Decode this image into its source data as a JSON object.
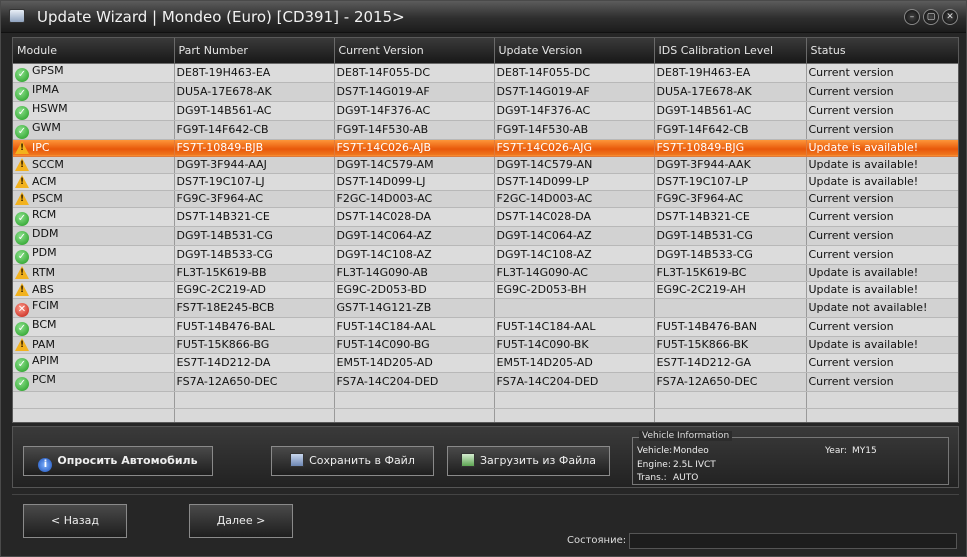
{
  "window": {
    "title": "Update Wizard | Mondeo (Euro) [CD391] - 2015>"
  },
  "table": {
    "columns": [
      "Module",
      "Part Number",
      "Current Version",
      "Update Version",
      "IDS Calibration Level",
      "Status"
    ],
    "rows": [
      {
        "status_icon": "ok",
        "module": "GPSM",
        "part": "DE8T-19H463-EA",
        "current": "DE8T-14F055-DC",
        "update": "DE8T-14F055-DC",
        "ids": "DE8T-19H463-EA",
        "status": "Current version"
      },
      {
        "status_icon": "ok",
        "module": "IPMA",
        "part": "DU5A-17E678-AK",
        "current": "DS7T-14G019-AF",
        "update": "DS7T-14G019-AF",
        "ids": "DU5A-17E678-AK",
        "status": "Current version"
      },
      {
        "status_icon": "ok",
        "module": "HSWM",
        "part": "DG9T-14B561-AC",
        "current": "DG9T-14F376-AC",
        "update": "DG9T-14F376-AC",
        "ids": "DG9T-14B561-AC",
        "status": "Current version"
      },
      {
        "status_icon": "ok",
        "module": "GWM",
        "part": "FG9T-14F642-CB",
        "current": "FG9T-14F530-AB",
        "update": "FG9T-14F530-AB",
        "ids": "FG9T-14F642-CB",
        "status": "Current version"
      },
      {
        "status_icon": "warn",
        "module": "IPC",
        "part": "FS7T-10849-BJB",
        "current": "FS7T-14C026-AJB",
        "update": "FS7T-14C026-AJG",
        "ids": "FS7T-10849-BJG",
        "status": "Update is available!",
        "selected": true
      },
      {
        "status_icon": "warn",
        "module": "SCCM",
        "part": "DG9T-3F944-AAJ",
        "current": "DG9T-14C579-AM",
        "update": "DG9T-14C579-AN",
        "ids": "DG9T-3F944-AAK",
        "status": "Update is available!"
      },
      {
        "status_icon": "warn",
        "module": "ACM",
        "part": "DS7T-19C107-LJ",
        "current": "DS7T-14D099-LJ",
        "update": "DS7T-14D099-LP",
        "ids": "DS7T-19C107-LP",
        "status": "Update is available!"
      },
      {
        "status_icon": "warn",
        "module": "PSCM",
        "part": "FG9C-3F964-AC",
        "current": "F2GC-14D003-AC",
        "update": "F2GC-14D003-AC",
        "ids": "FG9C-3F964-AC",
        "status": "Current version"
      },
      {
        "status_icon": "ok",
        "module": "RCM",
        "part": "DS7T-14B321-CE",
        "current": "DS7T-14C028-DA",
        "update": "DS7T-14C028-DA",
        "ids": "DS7T-14B321-CE",
        "status": "Current version"
      },
      {
        "status_icon": "ok",
        "module": "DDM",
        "part": "DG9T-14B531-CG",
        "current": "DG9T-14C064-AZ",
        "update": "DG9T-14C064-AZ",
        "ids": "DG9T-14B531-CG",
        "status": "Current version"
      },
      {
        "status_icon": "ok",
        "module": "PDM",
        "part": "DG9T-14B533-CG",
        "current": "DG9T-14C108-AZ",
        "update": "DG9T-14C108-AZ",
        "ids": "DG9T-14B533-CG",
        "status": "Current version"
      },
      {
        "status_icon": "warn",
        "module": "RTM",
        "part": "FL3T-15K619-BB",
        "current": "FL3T-14G090-AB",
        "update": "FL3T-14G090-AC",
        "ids": "FL3T-15K619-BC",
        "status": "Update is available!"
      },
      {
        "status_icon": "warn",
        "module": "ABS",
        "part": "EG9C-2C219-AD",
        "current": "EG9C-2D053-BD",
        "update": "EG9C-2D053-BH",
        "ids": "EG9C-2C219-AH",
        "status": "Update is available!"
      },
      {
        "status_icon": "err",
        "module": "FCIM",
        "part": "FS7T-18E245-BCB",
        "current": "GS7T-14G121-ZB",
        "update": "",
        "ids": "",
        "status": "Update not available!"
      },
      {
        "status_icon": "ok",
        "module": "BCM",
        "part": "FU5T-14B476-BAL",
        "current": "FU5T-14C184-AAL",
        "update": "FU5T-14C184-AAL",
        "ids": "FU5T-14B476-BAN",
        "status": "Current version"
      },
      {
        "status_icon": "warn",
        "module": "PAM",
        "part": "FU5T-15K866-BG",
        "current": "FU5T-14C090-BG",
        "update": "FU5T-14C090-BK",
        "ids": "FU5T-15K866-BK",
        "status": "Update is available!"
      },
      {
        "status_icon": "ok",
        "module": "APIM",
        "part": "ES7T-14D212-DA",
        "current": "EM5T-14D205-AD",
        "update": "EM5T-14D205-AD",
        "ids": "ES7T-14D212-GA",
        "status": "Current version"
      },
      {
        "status_icon": "ok",
        "module": "PCM",
        "part": "FS7A-12A650-DEC",
        "current": "FS7A-14C204-DED",
        "update": "FS7A-14C204-DED",
        "ids": "FS7A-12A650-DEC",
        "status": "Current version"
      }
    ]
  },
  "buttons": {
    "query_vehicle": "Опросить Автомобиль",
    "save_file": "Сохранить в Файл",
    "load_file": "Загрузить из Файла",
    "back": "< Назад",
    "next": "Далее >"
  },
  "vehicle_info": {
    "legend": "Vehicle Information",
    "vehicle_label": "Vehicle:",
    "vehicle": "Mondeo",
    "engine_label": "Engine:",
    "engine": "2.5L IVCT",
    "trans_label": "Trans.:",
    "trans": "AUTO",
    "year_label": "Year:",
    "year": "MY15"
  },
  "footer": {
    "status_label": "Состояние:",
    "status_value": ""
  },
  "icons": {
    "ok": "check-icon",
    "warn": "warning-icon",
    "err": "error-icon",
    "query": "info-icon",
    "save": "save-icon",
    "load": "load-icon"
  },
  "colors": {
    "selected_row": "#f07a22",
    "ok": "#1f9a1f",
    "warn": "#f2b21e",
    "err": "#c01a10"
  }
}
